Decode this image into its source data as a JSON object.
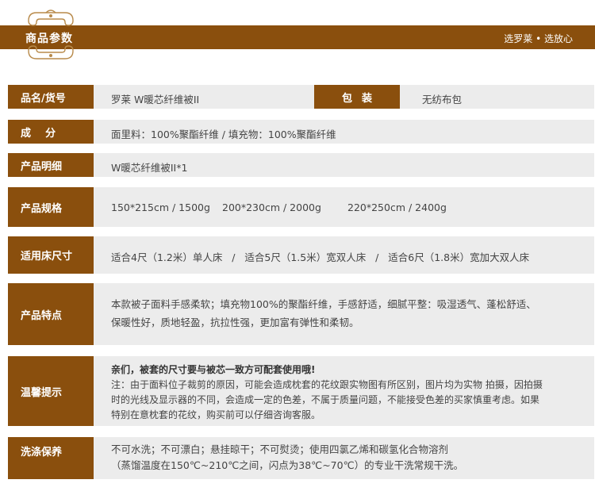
{
  "header": {
    "title": "商品参数",
    "slogan": "选罗莱 • 选放心"
  },
  "rows": {
    "name": {
      "label": "品名/货号",
      "value": "罗莱  W暖芯纤维被II",
      "pack_label": "包装",
      "pack_value": "无纺布包"
    },
    "material": {
      "label": "成    分",
      "value": "面里料：100%聚酯纤维  /  填充物：100%聚酯纤维"
    },
    "detail": {
      "label": "产品明细",
      "value": "W暖芯纤维被II*1"
    },
    "spec": {
      "label": "产品规格",
      "sizes": [
        "150*215cm / 1500g",
        "200*230cm / 2000g",
        "220*250cm / 2400g"
      ]
    },
    "bed": {
      "label": "适用床尺寸",
      "value": "适合4尺（1.2米）单人床   /   适合5尺（1.5米）宽双人床   /   适合6尺（1.8米）宽加大双人床"
    },
    "feature": {
      "label": "产品特点",
      "line1": "本款被子面料手感柔软；填充物100%的聚酯纤维，手感舒适，细腻平整：吸湿透气、蓬松舒适、",
      "line2": "保暖性好，质地轻盈，抗拉性强，更加富有弹性和柔韧。"
    },
    "tip": {
      "label": "温馨提示",
      "bold": "亲们，被套的尺寸要与被芯一致方可配套使用哦!",
      "line1": "注：由于面料位子裁剪的原因，可能会造成枕套的花纹跟实物图有所区别，图片均为实物 拍摄，因拍摄",
      "line2": "时的光线及显示器的不同，会造成一定的色差，不属于质量问题，不能接受色差的买家慎重考虑。如果",
      "line3": "特别在意枕套的花纹，购买前可以仔细咨询客服。"
    },
    "care": {
      "label": "洗涤保养",
      "line1": "不可水洗；不可漂白；悬挂晾干；不可熨烫；使用四氯乙烯和碳氢化合物溶剂",
      "line2": "（蒸馏温度在150℃~210℃之间，闪点为38℃~70℃）的专业干洗常规干洗。"
    }
  },
  "colors": {
    "brand": "#8a4f0d",
    "row_bg": "#ececec"
  }
}
